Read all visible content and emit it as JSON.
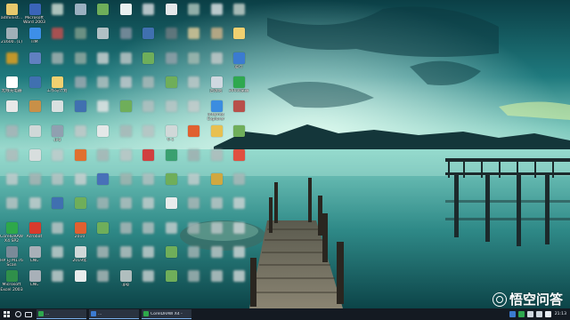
{
  "desktop": {
    "icons": [
      {
        "label": "administ...",
        "icon": "user-folder-icon",
        "color": "#e7c86c",
        "blur": false
      },
      {
        "label": "Microsoft\nWord 2003",
        "icon": "word-icon",
        "color": "#3a64b8",
        "blur": false
      },
      {
        "label": "",
        "icon": "file-icon",
        "color": "#c8d8d0",
        "blur": true
      },
      {
        "label": "",
        "icon": "app-icon",
        "color": "#9ab0c0",
        "blur": false
      },
      {
        "label": "",
        "icon": "file-icon",
        "color": "#6fae5a",
        "blur": false
      },
      {
        "label": "",
        "icon": "file-icon",
        "color": "#e8f0f0",
        "blur": false
      },
      {
        "label": "",
        "icon": "file-icon",
        "color": "#d0d8dc",
        "blur": true
      },
      {
        "label": "",
        "icon": "file-icon",
        "color": "#e4e8ea",
        "blur": false
      },
      {
        "label": "",
        "icon": "file-icon",
        "color": "#a8c0b8",
        "blur": true
      },
      {
        "label": "",
        "icon": "file-icon",
        "color": "#d8e0e2",
        "blur": true
      },
      {
        "label": "",
        "icon": "file-icon",
        "color": "#c0cec8",
        "blur": true
      },
      {
        "label": "21600..(1)",
        "icon": "image-icon",
        "color": "#a0b0b8",
        "blur": false
      },
      {
        "label": "TIM",
        "icon": "tim-icon",
        "color": "#3d8fe8",
        "blur": false
      },
      {
        "label": "",
        "icon": "app-icon",
        "color": "#c05050",
        "blur": true
      },
      {
        "label": "",
        "icon": "app-icon",
        "color": "#7a9a8a",
        "blur": true
      },
      {
        "label": "",
        "icon": "app-icon",
        "color": "#b0c0c4",
        "blur": false
      },
      {
        "label": "",
        "icon": "app-icon",
        "color": "#8090a0",
        "blur": true
      },
      {
        "label": "",
        "icon": "app-icon",
        "color": "#4070b0",
        "blur": false
      },
      {
        "label": "",
        "icon": "app-icon",
        "color": "#6a7a80",
        "blur": true
      },
      {
        "label": "",
        "icon": "app-icon",
        "color": "#d8c898",
        "blur": true
      },
      {
        "label": "",
        "icon": "app-icon",
        "color": "#c8b088",
        "blur": true
      },
      {
        "label": "",
        "icon": "folder-icon",
        "color": "#f0d070",
        "blur": false
      },
      {
        "label": "",
        "icon": "app-icon",
        "color": "#e0a020",
        "blur": true
      },
      {
        "label": "",
        "icon": "app-icon",
        "color": "#6080c0",
        "blur": false
      },
      {
        "label": "",
        "icon": "app-icon",
        "color": "#a0b0b0",
        "blur": true
      },
      {
        "label": "",
        "icon": "app-icon",
        "color": "#90a8a0",
        "blur": true
      },
      {
        "label": "",
        "icon": "app-icon",
        "color": "#c8d0d0",
        "blur": true
      },
      {
        "label": "",
        "icon": "app-icon",
        "color": "#b8c4c4",
        "blur": true
      },
      {
        "label": "",
        "icon": "app-icon",
        "color": "#6fae5a",
        "blur": false
      },
      {
        "label": "",
        "icon": "app-icon",
        "color": "#90a0a8",
        "blur": true
      },
      {
        "label": "",
        "icon": "app-icon",
        "color": "#a0b8b0",
        "blur": true
      },
      {
        "label": "",
        "icon": "app-icon",
        "color": "#c0c8c8",
        "blur": true
      },
      {
        "label": "运行",
        "icon": "app-icon",
        "color": "#3b7bd0",
        "blur": false
      },
      {
        "label": "无线充电器",
        "icon": "app-icon",
        "color": "#ffffff",
        "blur": false
      },
      {
        "label": "",
        "icon": "app-icon",
        "color": "#4070b0",
        "blur": false
      },
      {
        "label": "工作与计划",
        "icon": "folder-icon",
        "color": "#f0d070",
        "blur": false
      },
      {
        "label": "",
        "icon": "app-icon",
        "color": "#9aa8b0",
        "blur": true
      },
      {
        "label": "",
        "icon": "app-icon",
        "color": "#b0c0c0",
        "blur": true
      },
      {
        "label": "",
        "icon": "app-icon",
        "color": "#c0c8cc",
        "blur": true
      },
      {
        "label": "",
        "icon": "app-icon",
        "color": "#a8b8b8",
        "blur": true
      },
      {
        "label": "",
        "icon": "app-icon",
        "color": "#6fae5a",
        "blur": false
      },
      {
        "label": "",
        "icon": "app-icon",
        "color": "#bcc8c8",
        "blur": true
      },
      {
        "label": "回收站",
        "icon": "recycle-bin-icon",
        "color": "#cfd8e0",
        "blur": false
      },
      {
        "label": "360浏览器",
        "icon": "browser-icon",
        "color": "#2fa84f",
        "blur": false
      },
      {
        "label": "",
        "icon": "app-icon",
        "color": "#e8e8e8",
        "blur": false
      },
      {
        "label": "",
        "icon": "app-icon",
        "color": "#c89048",
        "blur": false
      },
      {
        "label": "",
        "icon": "app-icon",
        "color": "#d8e0e0",
        "blur": false
      },
      {
        "label": "",
        "icon": "app-icon",
        "color": "#4070b0",
        "blur": false
      },
      {
        "label": "",
        "icon": "app-icon",
        "color": "#e0e4e4",
        "blur": true
      },
      {
        "label": "",
        "icon": "app-icon",
        "color": "#6fae5a",
        "blur": false
      },
      {
        "label": "",
        "icon": "app-icon",
        "color": "#b0c0c0",
        "blur": true
      },
      {
        "label": "",
        "icon": "app-icon",
        "color": "#b8c6c6",
        "blur": true
      },
      {
        "label": "",
        "icon": "app-icon",
        "color": "#c4cccc",
        "blur": true
      },
      {
        "label": "Internet\nExplorer",
        "icon": "ie-icon",
        "color": "#3b8de0",
        "blur": false
      },
      {
        "label": "",
        "icon": "app-icon",
        "color": "#b8504a",
        "blur": false
      },
      {
        "label": "",
        "icon": "app-icon",
        "color": "#a8b4b8",
        "blur": true
      },
      {
        "label": "",
        "icon": "app-icon",
        "color": "#d0d8d8",
        "blur": false
      },
      {
        "label": ".jpg",
        "icon": "image-icon",
        "color": "#90a0b0",
        "blur": false
      },
      {
        "label": "",
        "icon": "app-icon",
        "color": "#c0c8c8",
        "blur": true
      },
      {
        "label": "",
        "icon": "app-icon",
        "color": "#e4e8e8",
        "blur": false
      },
      {
        "label": "",
        "icon": "app-icon",
        "color": "#a8b8b8",
        "blur": true
      },
      {
        "label": "",
        "icon": "app-icon",
        "color": "#b8c4c4",
        "blur": true
      },
      {
        "label": "6-1",
        "icon": "app-icon",
        "color": "#d0d8d8",
        "blur": false
      },
      {
        "label": "",
        "icon": "app-icon",
        "color": "#e06030",
        "blur": false
      },
      {
        "label": "",
        "icon": "app-icon",
        "color": "#e8c050",
        "blur": false
      },
      {
        "label": "",
        "icon": "app-icon",
        "color": "#6fae5a",
        "blur": false
      },
      {
        "label": "",
        "icon": "app-icon",
        "color": "#b0bcbc",
        "blur": true
      },
      {
        "label": "",
        "icon": "app-icon",
        "color": "#d8dede",
        "blur": false
      },
      {
        "label": "",
        "icon": "app-icon",
        "color": "#c0cccc",
        "blur": true
      },
      {
        "label": "",
        "icon": "app-icon",
        "color": "#e07030",
        "blur": false
      },
      {
        "label": "",
        "icon": "app-icon",
        "color": "#a8b6b6",
        "blur": true
      },
      {
        "label": "",
        "icon": "app-icon",
        "color": "#bcc6c6",
        "blur": true
      },
      {
        "label": "",
        "icon": "app-icon",
        "color": "#d04040",
        "blur": false
      },
      {
        "label": "",
        "icon": "app-icon",
        "color": "#3aa070",
        "blur": false
      },
      {
        "label": "",
        "icon": "app-icon",
        "color": "#a0b0b0",
        "blur": true
      },
      {
        "label": "",
        "icon": "app-icon",
        "color": "#b0bcbc",
        "blur": true
      },
      {
        "label": "",
        "icon": "app-icon",
        "color": "#e05040",
        "blur": false
      },
      {
        "label": "",
        "icon": "app-icon",
        "color": "#c0cccc",
        "blur": true
      },
      {
        "label": "",
        "icon": "app-icon",
        "color": "#a8b4b4",
        "blur": true
      },
      {
        "label": "",
        "icon": "app-icon",
        "color": "#b8c4c4",
        "blur": true
      },
      {
        "label": "",
        "icon": "app-icon",
        "color": "#c8d0d0",
        "blur": true
      },
      {
        "label": "",
        "icon": "app-icon",
        "color": "#4870b8",
        "blur": false
      },
      {
        "label": "",
        "icon": "app-icon",
        "color": "#a0b4b0",
        "blur": true
      },
      {
        "label": "",
        "icon": "app-icon",
        "color": "#b0c0c0",
        "blur": true
      },
      {
        "label": "",
        "icon": "app-icon",
        "color": "#6fae5a",
        "blur": false
      },
      {
        "label": "",
        "icon": "app-icon",
        "color": "#c0cccc",
        "blur": true
      },
      {
        "label": "",
        "icon": "app-icon",
        "color": "#d0a840",
        "blur": false
      },
      {
        "label": "",
        "icon": "app-icon",
        "color": "#a8b8b8",
        "blur": true
      },
      {
        "label": "",
        "icon": "app-icon",
        "color": "#b8c4c4",
        "blur": true
      },
      {
        "label": "",
        "icon": "app-icon",
        "color": "#c4cece",
        "blur": true
      },
      {
        "label": "",
        "icon": "app-icon",
        "color": "#4070b0",
        "blur": false
      },
      {
        "label": "",
        "icon": "app-icon",
        "color": "#6fae5a",
        "blur": false
      },
      {
        "label": "",
        "icon": "app-icon",
        "color": "#a0b4b4",
        "blur": true
      },
      {
        "label": "",
        "icon": "app-icon",
        "color": "#b0bebe",
        "blur": true
      },
      {
        "label": "",
        "icon": "app-icon",
        "color": "#c0cccc",
        "blur": true
      },
      {
        "label": "",
        "icon": "app-icon",
        "color": "#e8ecec",
        "blur": false
      },
      {
        "label": "",
        "icon": "app-icon",
        "color": "#a8b6b6",
        "blur": true
      },
      {
        "label": "",
        "icon": "app-icon",
        "color": "#b8c4c4",
        "blur": true
      },
      {
        "label": "",
        "icon": "app-icon",
        "color": "#c8d2d2",
        "blur": true
      },
      {
        "label": "CorelDRAW\nX4 SP2",
        "icon": "coreldraw-icon",
        "color": "#2ea84a",
        "blur": false
      },
      {
        "label": "Acrobat",
        "icon": "acrobat-icon",
        "color": "#d83b2c",
        "blur": false
      },
      {
        "label": "",
        "icon": "app-icon",
        "color": "#b8c4c4",
        "blur": true
      },
      {
        "label": "2010",
        "icon": "app-icon",
        "color": "#e06030",
        "blur": false
      },
      {
        "label": "",
        "icon": "app-icon",
        "color": "#6fae5a",
        "blur": false
      },
      {
        "label": "",
        "icon": "app-icon",
        "color": "#a8b6b6",
        "blur": true
      },
      {
        "label": "",
        "icon": "app-icon",
        "color": "#b0bebe",
        "blur": true
      },
      {
        "label": "",
        "icon": "app-icon",
        "color": "#c0cccc",
        "blur": true
      },
      {
        "label": "",
        "icon": "app-icon",
        "color": "#a0b2b2",
        "blur": true
      },
      {
        "label": "",
        "icon": "app-icon",
        "color": "#b8c4c4",
        "blur": true
      },
      {
        "label": "",
        "icon": "app-icon",
        "color": "#c8d2d2",
        "blur": true
      },
      {
        "label": "HP LJ M176\nScan",
        "icon": "scanner-icon",
        "color": "#7a8a98",
        "blur": false
      },
      {
        "label": "CNC",
        "icon": "app-icon",
        "color": "#a8b0b8",
        "blur": false
      },
      {
        "label": "",
        "icon": "app-icon",
        "color": "#c0cccc",
        "blur": true
      },
      {
        "label": "2019年",
        "icon": "app-icon",
        "color": "#d0d8d8",
        "blur": false
      },
      {
        "label": "",
        "icon": "app-icon",
        "color": "#a8b6b6",
        "blur": true
      },
      {
        "label": "",
        "icon": "app-icon",
        "color": "#b4c0c0",
        "blur": true
      },
      {
        "label": "",
        "icon": "app-icon",
        "color": "#c0cccc",
        "blur": true
      },
      {
        "label": "",
        "icon": "app-icon",
        "color": "#6fae5a",
        "blur": false
      },
      {
        "label": "",
        "icon": "app-icon",
        "color": "#a0b2b2",
        "blur": true
      },
      {
        "label": "",
        "icon": "app-icon",
        "color": "#b8c4c4",
        "blur": true
      },
      {
        "label": "",
        "icon": "app-icon",
        "color": "#c8d2d2",
        "blur": true
      },
      {
        "label": "Microsoft\nExcel 2003",
        "icon": "excel-icon",
        "color": "#2f8f4a",
        "blur": false
      },
      {
        "label": "CNC",
        "icon": "app-icon",
        "color": "#a8b0b8",
        "blur": false
      },
      {
        "label": "",
        "icon": "app-icon",
        "color": "#c0cccc",
        "blur": true
      },
      {
        "label": "",
        "icon": "app-icon",
        "color": "#e8ecec",
        "blur": false
      },
      {
        "label": "",
        "icon": "app-icon",
        "color": "#a8b6b6",
        "blur": true
      },
      {
        "label": ".jpg",
        "icon": "image-icon",
        "color": "#b0bebe",
        "blur": false
      },
      {
        "label": "",
        "icon": "app-icon",
        "color": "#c0cccc",
        "blur": true
      },
      {
        "label": "",
        "icon": "app-icon",
        "color": "#6fae5a",
        "blur": false
      },
      {
        "label": "",
        "icon": "app-icon",
        "color": "#a0b2b2",
        "blur": true
      },
      {
        "label": "",
        "icon": "app-icon",
        "color": "#b8c4c4",
        "blur": true
      },
      {
        "label": "",
        "icon": "app-icon",
        "color": "#c8d2d2",
        "blur": true
      }
    ]
  },
  "taskbar": {
    "tasks": [
      {
        "label": "...",
        "icon": "browser-icon",
        "color": "#2fa84f"
      },
      {
        "label": "...",
        "icon": "app-icon",
        "color": "#3b7bd0"
      },
      {
        "label": "CorelDRAW X4 -",
        "icon": "coreldraw-icon",
        "color": "#2ea84a"
      }
    ],
    "clock": {
      "time": "21:13",
      "date": ""
    }
  },
  "watermark": {
    "text": "悟空问答"
  },
  "colors": {
    "taskbar": "#141a22",
    "accent": "#7bb3f0"
  }
}
